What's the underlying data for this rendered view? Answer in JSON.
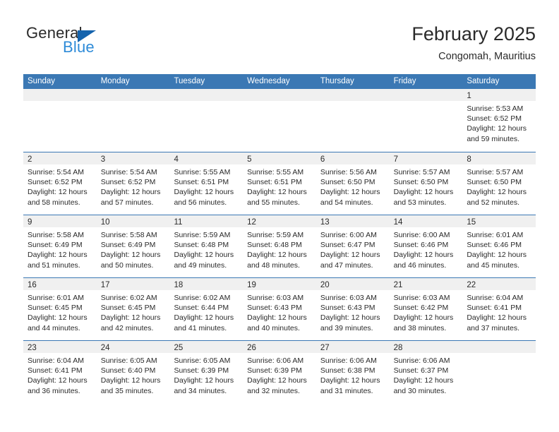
{
  "brand": {
    "name_top": "General",
    "name_bottom": "Blue",
    "triangle_color": "#1463ad",
    "blue_text_color": "#2e8bd8"
  },
  "header": {
    "title": "February 2025",
    "subtitle": "Congomah, Mauritius"
  },
  "theme": {
    "header_blue": "#3b78b4",
    "daynum_band": "#f0f0f0",
    "text": "#2a2a2a"
  },
  "calendar": {
    "weekday_headers": [
      "Sunday",
      "Monday",
      "Tuesday",
      "Wednesday",
      "Thursday",
      "Friday",
      "Saturday"
    ],
    "weeks": [
      [
        {
          "day": "",
          "sunrise": "",
          "sunset": "",
          "daylight_line1": "",
          "daylight_line2": ""
        },
        {
          "day": "",
          "sunrise": "",
          "sunset": "",
          "daylight_line1": "",
          "daylight_line2": ""
        },
        {
          "day": "",
          "sunrise": "",
          "sunset": "",
          "daylight_line1": "",
          "daylight_line2": ""
        },
        {
          "day": "",
          "sunrise": "",
          "sunset": "",
          "daylight_line1": "",
          "daylight_line2": ""
        },
        {
          "day": "",
          "sunrise": "",
          "sunset": "",
          "daylight_line1": "",
          "daylight_line2": ""
        },
        {
          "day": "",
          "sunrise": "",
          "sunset": "",
          "daylight_line1": "",
          "daylight_line2": ""
        },
        {
          "day": "1",
          "sunrise": "Sunrise: 5:53 AM",
          "sunset": "Sunset: 6:52 PM",
          "daylight_line1": "Daylight: 12 hours",
          "daylight_line2": "and 59 minutes."
        }
      ],
      [
        {
          "day": "2",
          "sunrise": "Sunrise: 5:54 AM",
          "sunset": "Sunset: 6:52 PM",
          "daylight_line1": "Daylight: 12 hours",
          "daylight_line2": "and 58 minutes."
        },
        {
          "day": "3",
          "sunrise": "Sunrise: 5:54 AM",
          "sunset": "Sunset: 6:52 PM",
          "daylight_line1": "Daylight: 12 hours",
          "daylight_line2": "and 57 minutes."
        },
        {
          "day": "4",
          "sunrise": "Sunrise: 5:55 AM",
          "sunset": "Sunset: 6:51 PM",
          "daylight_line1": "Daylight: 12 hours",
          "daylight_line2": "and 56 minutes."
        },
        {
          "day": "5",
          "sunrise": "Sunrise: 5:55 AM",
          "sunset": "Sunset: 6:51 PM",
          "daylight_line1": "Daylight: 12 hours",
          "daylight_line2": "and 55 minutes."
        },
        {
          "day": "6",
          "sunrise": "Sunrise: 5:56 AM",
          "sunset": "Sunset: 6:50 PM",
          "daylight_line1": "Daylight: 12 hours",
          "daylight_line2": "and 54 minutes."
        },
        {
          "day": "7",
          "sunrise": "Sunrise: 5:57 AM",
          "sunset": "Sunset: 6:50 PM",
          "daylight_line1": "Daylight: 12 hours",
          "daylight_line2": "and 53 minutes."
        },
        {
          "day": "8",
          "sunrise": "Sunrise: 5:57 AM",
          "sunset": "Sunset: 6:50 PM",
          "daylight_line1": "Daylight: 12 hours",
          "daylight_line2": "and 52 minutes."
        }
      ],
      [
        {
          "day": "9",
          "sunrise": "Sunrise: 5:58 AM",
          "sunset": "Sunset: 6:49 PM",
          "daylight_line1": "Daylight: 12 hours",
          "daylight_line2": "and 51 minutes."
        },
        {
          "day": "10",
          "sunrise": "Sunrise: 5:58 AM",
          "sunset": "Sunset: 6:49 PM",
          "daylight_line1": "Daylight: 12 hours",
          "daylight_line2": "and 50 minutes."
        },
        {
          "day": "11",
          "sunrise": "Sunrise: 5:59 AM",
          "sunset": "Sunset: 6:48 PM",
          "daylight_line1": "Daylight: 12 hours",
          "daylight_line2": "and 49 minutes."
        },
        {
          "day": "12",
          "sunrise": "Sunrise: 5:59 AM",
          "sunset": "Sunset: 6:48 PM",
          "daylight_line1": "Daylight: 12 hours",
          "daylight_line2": "and 48 minutes."
        },
        {
          "day": "13",
          "sunrise": "Sunrise: 6:00 AM",
          "sunset": "Sunset: 6:47 PM",
          "daylight_line1": "Daylight: 12 hours",
          "daylight_line2": "and 47 minutes."
        },
        {
          "day": "14",
          "sunrise": "Sunrise: 6:00 AM",
          "sunset": "Sunset: 6:46 PM",
          "daylight_line1": "Daylight: 12 hours",
          "daylight_line2": "and 46 minutes."
        },
        {
          "day": "15",
          "sunrise": "Sunrise: 6:01 AM",
          "sunset": "Sunset: 6:46 PM",
          "daylight_line1": "Daylight: 12 hours",
          "daylight_line2": "and 45 minutes."
        }
      ],
      [
        {
          "day": "16",
          "sunrise": "Sunrise: 6:01 AM",
          "sunset": "Sunset: 6:45 PM",
          "daylight_line1": "Daylight: 12 hours",
          "daylight_line2": "and 44 minutes."
        },
        {
          "day": "17",
          "sunrise": "Sunrise: 6:02 AM",
          "sunset": "Sunset: 6:45 PM",
          "daylight_line1": "Daylight: 12 hours",
          "daylight_line2": "and 42 minutes."
        },
        {
          "day": "18",
          "sunrise": "Sunrise: 6:02 AM",
          "sunset": "Sunset: 6:44 PM",
          "daylight_line1": "Daylight: 12 hours",
          "daylight_line2": "and 41 minutes."
        },
        {
          "day": "19",
          "sunrise": "Sunrise: 6:03 AM",
          "sunset": "Sunset: 6:43 PM",
          "daylight_line1": "Daylight: 12 hours",
          "daylight_line2": "and 40 minutes."
        },
        {
          "day": "20",
          "sunrise": "Sunrise: 6:03 AM",
          "sunset": "Sunset: 6:43 PM",
          "daylight_line1": "Daylight: 12 hours",
          "daylight_line2": "and 39 minutes."
        },
        {
          "day": "21",
          "sunrise": "Sunrise: 6:03 AM",
          "sunset": "Sunset: 6:42 PM",
          "daylight_line1": "Daylight: 12 hours",
          "daylight_line2": "and 38 minutes."
        },
        {
          "day": "22",
          "sunrise": "Sunrise: 6:04 AM",
          "sunset": "Sunset: 6:41 PM",
          "daylight_line1": "Daylight: 12 hours",
          "daylight_line2": "and 37 minutes."
        }
      ],
      [
        {
          "day": "23",
          "sunrise": "Sunrise: 6:04 AM",
          "sunset": "Sunset: 6:41 PM",
          "daylight_line1": "Daylight: 12 hours",
          "daylight_line2": "and 36 minutes."
        },
        {
          "day": "24",
          "sunrise": "Sunrise: 6:05 AM",
          "sunset": "Sunset: 6:40 PM",
          "daylight_line1": "Daylight: 12 hours",
          "daylight_line2": "and 35 minutes."
        },
        {
          "day": "25",
          "sunrise": "Sunrise: 6:05 AM",
          "sunset": "Sunset: 6:39 PM",
          "daylight_line1": "Daylight: 12 hours",
          "daylight_line2": "and 34 minutes."
        },
        {
          "day": "26",
          "sunrise": "Sunrise: 6:06 AM",
          "sunset": "Sunset: 6:39 PM",
          "daylight_line1": "Daylight: 12 hours",
          "daylight_line2": "and 32 minutes."
        },
        {
          "day": "27",
          "sunrise": "Sunrise: 6:06 AM",
          "sunset": "Sunset: 6:38 PM",
          "daylight_line1": "Daylight: 12 hours",
          "daylight_line2": "and 31 minutes."
        },
        {
          "day": "28",
          "sunrise": "Sunrise: 6:06 AM",
          "sunset": "Sunset: 6:37 PM",
          "daylight_line1": "Daylight: 12 hours",
          "daylight_line2": "and 30 minutes."
        },
        {
          "day": "",
          "sunrise": "",
          "sunset": "",
          "daylight_line1": "",
          "daylight_line2": ""
        }
      ]
    ]
  }
}
